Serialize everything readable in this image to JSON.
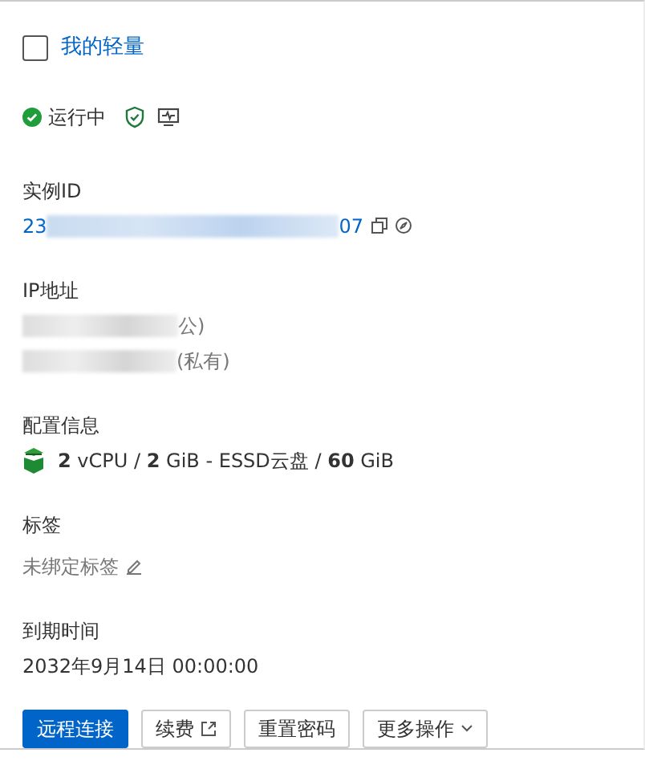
{
  "header": {
    "checked": false,
    "title": "我的轻量"
  },
  "status": {
    "text": "运行中"
  },
  "sections": [
    {
      "kind": "id",
      "label": "实例ID",
      "prefix": "23",
      "suffix": "07"
    },
    {
      "kind": "ip",
      "label": "IP地址",
      "lines": [
        "公)",
        "(私有)"
      ]
    },
    {
      "kind": "config",
      "label": "配置信息",
      "value": "**2** vCPU / **2** GiB - ESSD云盘 / **60** GiB"
    },
    {
      "kind": "tags",
      "label": "标签",
      "value": "未绑定标签"
    },
    {
      "kind": "text",
      "label": "到期时间",
      "value": "2032年9月14日 00:00:00"
    }
  ],
  "buttons": [
    {
      "label": "远程连接",
      "kind": "primary"
    },
    {
      "label": "续费",
      "kind": "external"
    },
    {
      "label": "重置密码",
      "kind": "plain"
    },
    {
      "label": "更多操作",
      "kind": "dropdown"
    }
  ]
}
